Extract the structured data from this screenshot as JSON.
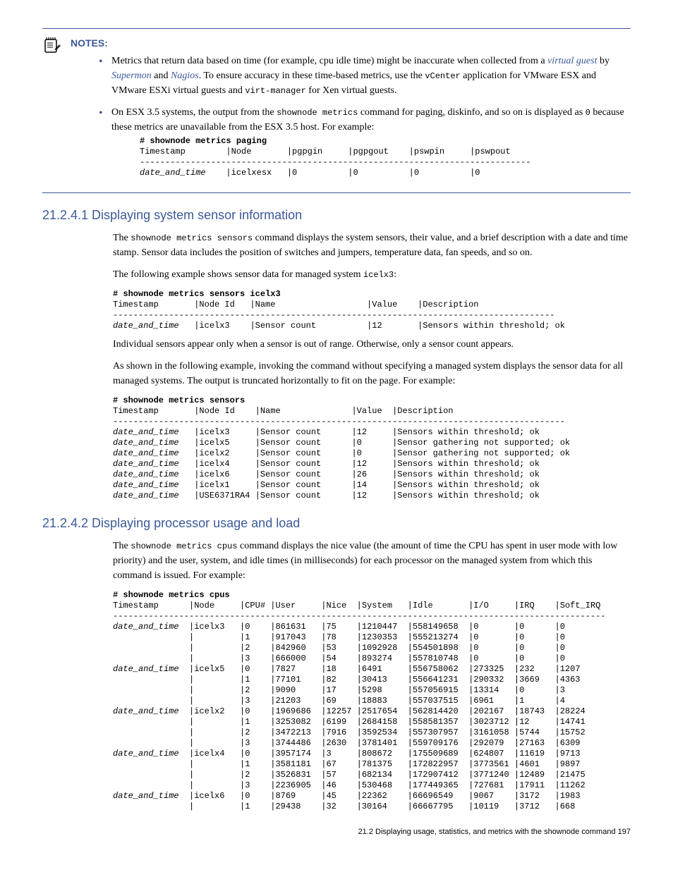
{
  "notes": {
    "heading": "NOTES:",
    "items": [
      {
        "pre": "Metrics that return data based on time (for example, cpu idle time) might be inaccurate when collected from a ",
        "vg": "virtual guest",
        "mid1": " by ",
        "sm": "Supermon",
        "mid2": " and ",
        "na": "Nagios",
        "post1": ". To ensure accuracy in these time-based metrics, use the ",
        "code1": "vCenter",
        "post2": " application for VMware ESX and VMware ESXi virtual guests and ",
        "code2": "virt-manager",
        "post3": " for Xen virtual guests."
      },
      {
        "pre": "On ESX 3.5 systems, the output from the ",
        "code1": "shownode metrics",
        "mid": " command for paging, diskinfo, and so on is displayed as ",
        "code2": "0",
        "post": " because these metrics are unavailable from the ESX 3.5 host. For example:"
      }
    ],
    "example_cmd": "# shownode metrics paging",
    "example_body": "Timestamp        |Node       |pgpgin     |pgpgout    |pswpin     |pswpout\n-----------------------------------------------------------------------------\ndate_and_time    |icelxesx   |0          |0          |0          |0"
  },
  "sec1": {
    "title": "21.2.4.1 Displaying system sensor information",
    "p1a": "The ",
    "p1code": "shownode metrics sensors",
    "p1b": " command displays the system sensors, their value, and a brief description with a date and time stamp. Sensor data includes the position of switches and jumpers, temperature data, fan speeds, and so on.",
    "p2a": "The following example shows sensor data for managed system ",
    "p2code": "icelx3",
    "p2b": ":",
    "ex1_cmd": "# shownode metrics sensors icelx3",
    "ex1_body": "Timestamp       |Node Id   |Name                  |Value    |Description\n---------------------------------------------------------------------------------------\ndate_and_time   |icelx3    |Sensor count          |12       |Sensors within threshold; ok",
    "p3": "Individual sensors appear only when a sensor is out of range. Otherwise, only a sensor count appears.",
    "p4": "As shown in the following example, invoking the command without specifying a managed system displays the sensor data for all managed systems. The output is truncated horizontally to fit on the page. For example:",
    "ex2_cmd": "# shownode metrics sensors",
    "ex2_body": "Timestamp       |Node Id    |Name              |Value  |Description\n-----------------------------------------------------------------------------------------\ndate_and_time   |icelx3     |Sensor count      |12     |Sensors within threshold; ok\ndate_and_time   |icelx5     |Sensor count      |0      |Sensor gathering not supported; ok\ndate_and_time   |icelx2     |Sensor count      |0      |Sensor gathering not supported; ok\ndate_and_time   |icelx4     |Sensor count      |12     |Sensors within threshold; ok\ndate_and_time   |icelx6     |Sensor count      |26     |Sensors within threshold; ok\ndate_and_time   |icelx1     |Sensor count      |14     |Sensors within threshold; ok\ndate_and_time   |USE6371RA4 |Sensor count      |12     |Sensors within threshold; ok"
  },
  "sec2": {
    "title": "21.2.4.2 Displaying processor usage and load",
    "p1a": "The ",
    "p1code": "shownode metrics cpus",
    "p1b": " command displays the nice value (the amount of time the CPU has spent in user mode with low priority) and the user, system, and idle times (in milliseconds) for each processor on the managed system from which this command is issued. For example:",
    "ex_cmd": "# shownode metrics cpus",
    "ex_body": "Timestamp      |Node     |CPU# |User     |Nice  |System   |Idle       |I/O     |IRQ    |Soft_IRQ\n-------------------------------------------------------------------------------------------------\ndate_and_time  |icelx3   |0    |861631   |75    |1210447  |558149658  |0       |0      |0\n               |         |1    |917043   |78    |1230353  |555213274  |0       |0      |0\n               |         |2    |842960   |53    |1092928  |554501898  |0       |0      |0\n               |         |3    |666000   |54    |893274   |557810748  |0       |0      |0\ndate_and_time  |icelx5   |0    |7827     |18    |6491     |556758062  |273325  |232    |1207\n               |         |1    |77101    |82    |30413    |556641231  |290332  |3669   |4363\n               |         |2    |9090     |17    |5298     |557056915  |13314   |0      |3\n               |         |3    |21203    |69    |18883    |557037515  |6961    |1      |4\ndate_and_time  |icelx2   |0    |1969686  |12257 |2517654  |562814420  |202167  |18743  |28224\n               |         |1    |3253082  |6199  |2684158  |558581357  |3023712 |12     |14741\n               |         |2    |3472213  |7916  |3592534  |557307957  |3161058 |5744   |15752\n               |         |3    |3744486  |2630  |3781401  |559709176  |292079  |27163  |6309\ndate_and_time  |icelx4   |0    |3957174  |3     |808672   |175509689  |624807  |11619  |9713\n               |         |1    |3581181  |67    |781375   |172822957  |3773561 |4601   |9897\n               |         |2    |3526831  |57    |682134   |172907412  |3771240 |12489  |21475\n               |         |3    |2236905  |46    |530468   |177449365  |727681  |17911  |11262\ndate_and_time  |icelx6   |0    |8769     |45    |22362    |66696549   |9067    |3172   |1983\n               |         |1    |29438    |32    |30164    |66667795   |10119   |3712   |668"
  },
  "footer": "21.2 Displaying usage, statistics, and metrics with the shownode command    197"
}
